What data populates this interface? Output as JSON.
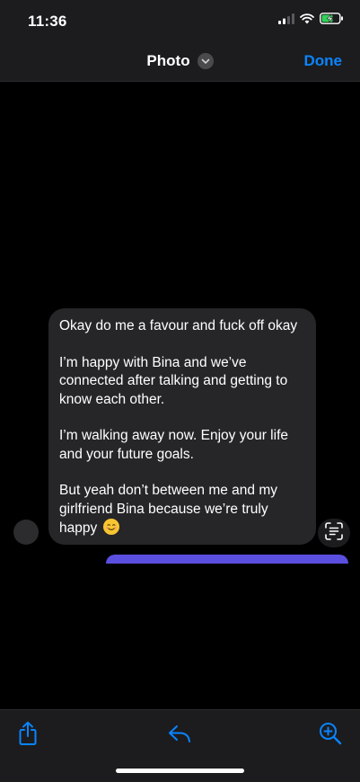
{
  "status_bar": {
    "time": "11:36",
    "icons": [
      "cellular-signal-icon",
      "wifi-icon",
      "battery-charging-icon"
    ]
  },
  "nav": {
    "title": "Photo",
    "title_menu_icon": "chevron-down-icon",
    "done_label": "Done"
  },
  "message": {
    "paragraphs": [
      "Okay do me a favour and fuck off okay",
      "I’m happy with Bina and we’ve connected after talking and getting to know each other.",
      "I’m walking away now. Enjoy your life and your future goals.",
      "But yeah don’t between me and my girlfriend Bina because we’re truly happy"
    ],
    "trailing_emoji": "smiling-face-emoji",
    "bubble_color": "#262628",
    "next_bubble_color": "#5b4fe0"
  },
  "toolbar": {
    "share_icon": "share-icon",
    "reply_icon": "reply-icon",
    "zoom_icon": "zoom-in-icon"
  },
  "colors": {
    "accent": "#0a84ff",
    "background": "#000000",
    "bar": "#1c1c1e"
  }
}
